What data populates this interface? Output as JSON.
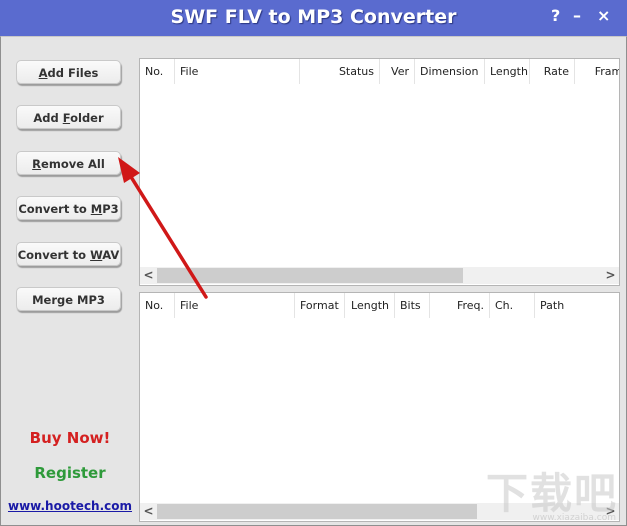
{
  "window": {
    "title": "SWF FLV to MP3 Converter",
    "help_label": "?",
    "minimize_label": "–",
    "close_label": "×"
  },
  "sidebar": {
    "buttons": [
      {
        "pre": "",
        "ul": "A",
        "post": "dd Files"
      },
      {
        "pre": "Add ",
        "ul": "F",
        "post": "older"
      },
      {
        "pre": "",
        "ul": "R",
        "post": "emove All"
      },
      {
        "pre": "Convert to ",
        "ul": "M",
        "post": "P3"
      },
      {
        "pre": "Convert to ",
        "ul": "W",
        "post": "AV"
      },
      {
        "pre": "Merge MP3",
        "ul": "",
        "post": ""
      }
    ],
    "buy_now": "Buy Now!",
    "register": "Register",
    "website": "www.hootech.com"
  },
  "source_list": {
    "columns": [
      "No.",
      "File",
      "Status",
      "Ver",
      "Dimension",
      "Length",
      "Rate",
      "Frame"
    ],
    "rows": [],
    "scroll_left": "<",
    "scroll_right": ">"
  },
  "output_list": {
    "columns": [
      "No.",
      "File",
      "Format",
      "Length",
      "Bits",
      "Freq.",
      "Ch.",
      "Path"
    ],
    "rows": [],
    "scroll_left": "<",
    "scroll_right": ">"
  },
  "colors": {
    "titlebar": "#5a6bcf",
    "buy_now": "#d42020",
    "register": "#2e9a3a",
    "website": "#1a1aa6",
    "annotation_arrow": "#d01818"
  },
  "watermark": {
    "text": "下载吧",
    "sub": "www.xiazaiba.com"
  }
}
